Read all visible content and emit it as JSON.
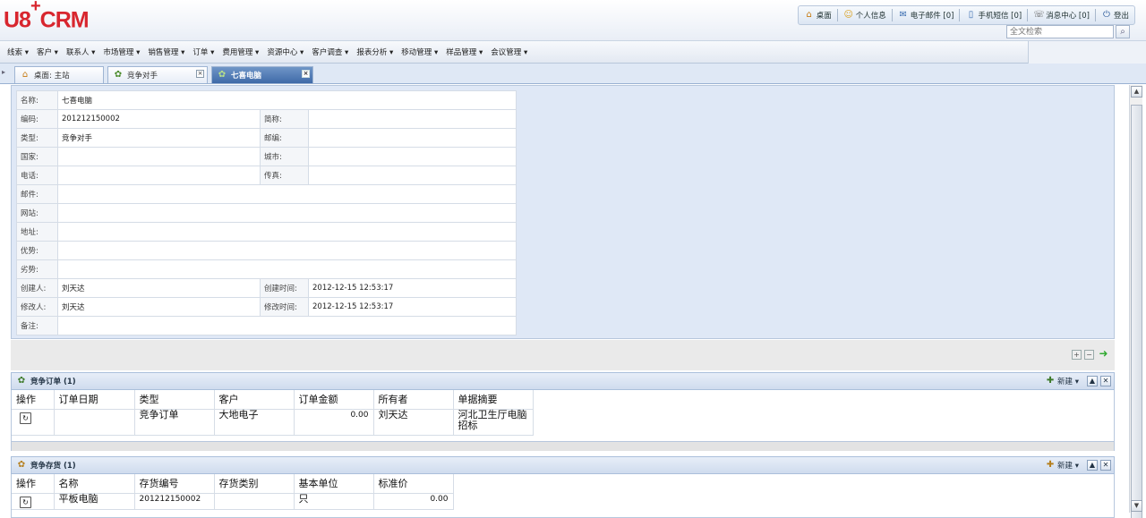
{
  "app": {
    "logo_main": "U8",
    "logo_plus": "+",
    "logo_tail": "CRM"
  },
  "topnav": [
    {
      "icon": "home-icon",
      "glyph": "⌂",
      "label": "桌面"
    },
    {
      "icon": "user-icon",
      "glyph": "☺",
      "label": "个人信息"
    },
    {
      "icon": "mail-icon",
      "glyph": "✉",
      "label": "电子邮件 [0]"
    },
    {
      "icon": "phone-icon",
      "glyph": "▯",
      "label": "手机短信 [0]"
    },
    {
      "icon": "message-icon",
      "glyph": "☏",
      "label": "消息中心 [0]"
    },
    {
      "icon": "logout-icon",
      "glyph": "⏻",
      "label": "登出"
    }
  ],
  "search": {
    "placeholder": "全文检索"
  },
  "menu": [
    "线索 ▾",
    "客户 ▾",
    "联系人 ▾",
    "市场管理 ▾",
    "销售管理 ▾",
    "订单 ▾",
    "费用管理 ▾",
    "资源中心 ▾",
    "客户调查 ▾",
    "报表分析 ▾",
    "移动管理 ▾",
    "样品管理 ▾",
    "会议管理 ▾"
  ],
  "tabs": [
    {
      "label": "桌面: 主站"
    },
    {
      "label": "竞争对手"
    },
    {
      "label": "七喜电脑"
    }
  ],
  "record": {
    "name_label": "名称:",
    "name": "七喜电脑",
    "code_label": "编码:",
    "code": "201212150002",
    "short_label": "简称:",
    "short": "",
    "type_label": "类型:",
    "type": "竞争对手",
    "zip_label": "邮编:",
    "zip": "",
    "country_label": "国家:",
    "country": "",
    "city_label": "城市:",
    "city": "",
    "phone_label": "电话:",
    "phone": "",
    "fax_label": "传真:",
    "fax": "",
    "email_label": "邮件:",
    "email": "",
    "site_label": "网站:",
    "site": "",
    "address_label": "地址:",
    "address": "",
    "strength_label": "优势:",
    "strength": "",
    "weakness_label": "劣势:",
    "weakness": "",
    "creator_label": "创建人:",
    "creator": "刘天达",
    "created_label": "创建时间:",
    "created": "2012-12-15 12:53:17",
    "modifier_label": "修改人:",
    "modifier": "刘天达",
    "modified_label": "修改时间:",
    "modified": "2012-12-15 12:53:17",
    "remark_label": "备注:",
    "remark": ""
  },
  "orders_panel": {
    "title": "竞争订单 (1)",
    "new_label": "新建 ▾",
    "columns": [
      "操作",
      "订单日期",
      "类型",
      "客户",
      "订单金额",
      "所有者",
      "单据摘要"
    ],
    "rows": [
      {
        "date": "",
        "type": "竞争订单",
        "customer": "大地电子",
        "amount": "0.00",
        "owner": "刘天达",
        "summary": "河北卫生厅电脑招标"
      }
    ]
  },
  "products_panel": {
    "title": "竞争存货 (1)",
    "new_label": "新建 ▾",
    "columns": [
      "操作",
      "名称",
      "存货编号",
      "存货类别",
      "基本单位",
      "标准价"
    ],
    "rows": [
      {
        "name": "平板电脑",
        "code": "201212150002",
        "category": "",
        "unit": "只",
        "price": "0.00"
      }
    ]
  }
}
